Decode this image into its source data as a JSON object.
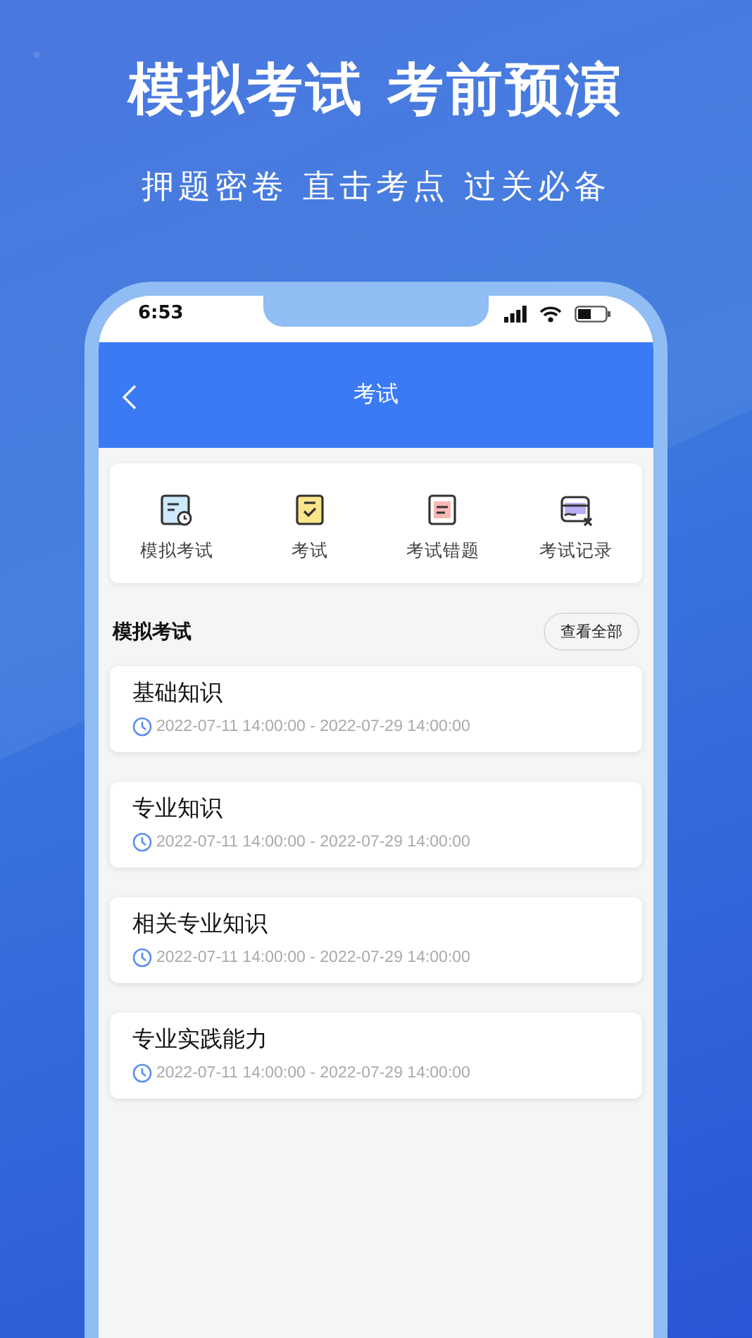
{
  "banner": {
    "title": "模拟考试 考前预演",
    "subtitle": "押题密卷 直击考点 过关必备"
  },
  "status_bar": {
    "time": "6:53"
  },
  "nav": {
    "title": "考试"
  },
  "shortcuts": [
    {
      "label": "模拟考试",
      "kind": "mock"
    },
    {
      "label": "考试",
      "kind": "exam"
    },
    {
      "label": "考试错题",
      "kind": "mistakes"
    },
    {
      "label": "考试记录",
      "kind": "records"
    }
  ],
  "section": {
    "title": "模拟考试",
    "action": "查看全部"
  },
  "exams": [
    {
      "name": "基础知识",
      "period": "2022-07-11 14:00:00 - 2022-07-29 14:00:00"
    },
    {
      "name": "专业知识",
      "period": "2022-07-11 14:00:00 - 2022-07-29 14:00:00"
    },
    {
      "name": "相关专业知识",
      "period": "2022-07-11 14:00:00 - 2022-07-29 14:00:00"
    },
    {
      "name": "专业实践能力",
      "period": "2022-07-11 14:00:00 - 2022-07-29 14:00:00"
    }
  ]
}
